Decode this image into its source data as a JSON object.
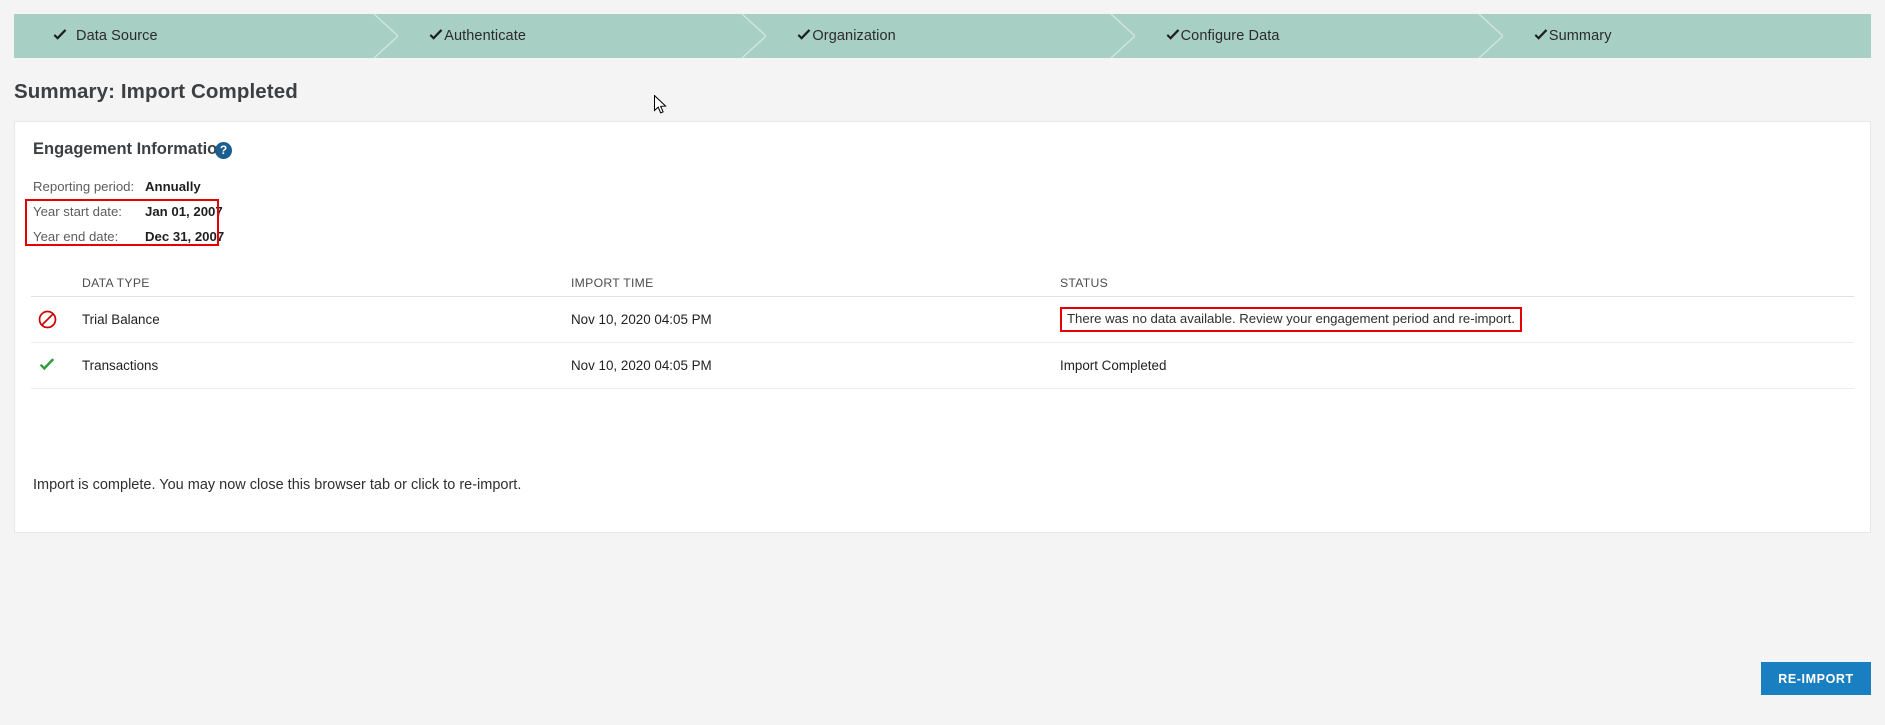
{
  "wizard": {
    "steps": [
      {
        "label": "Data Source",
        "icon": "check-icon",
        "complete": true
      },
      {
        "label": "Authenticate",
        "icon": "check-icon",
        "complete": true
      },
      {
        "label": "Organization",
        "icon": "check-icon",
        "complete": true
      },
      {
        "label": "Configure Data",
        "icon": "check-icon",
        "complete": true
      },
      {
        "label": "Summary",
        "icon": "check-icon",
        "complete": true
      }
    ],
    "bar_color": "#a8cfc4"
  },
  "page": {
    "title": "Summary: Import Completed"
  },
  "card": {
    "title": "Engagement Information",
    "help_icon_label": "?",
    "info": [
      {
        "label": "Reporting period:",
        "value": "Annually"
      },
      {
        "label": "Year start date:",
        "value": "Jan 01, 2007"
      },
      {
        "label": "Year end date:",
        "value": "Dec 31, 2007"
      }
    ],
    "highlight_color": "#e60000"
  },
  "table": {
    "headers": {
      "data_type": "DATA TYPE",
      "import_time": "IMPORT TIME",
      "status": "STATUS"
    },
    "rows": [
      {
        "icon": "no-entry-icon",
        "icon_color": "#cc0000",
        "data_type": "Trial Balance",
        "import_time": "Nov 10, 2020 04:05 PM",
        "status": "There was no data available. Review your engagement period and re-import.",
        "status_error": true
      },
      {
        "icon": "check-icon",
        "icon_color": "#2e9e3e",
        "data_type": "Transactions",
        "import_time": "Nov 10, 2020 04:05 PM",
        "status": "Import Completed",
        "status_error": false
      }
    ]
  },
  "footer": {
    "note": "Import is complete. You may now close this browser tab or click to re-import.",
    "reimport_label": "RE-IMPORT",
    "reimport_color": "#1a7fc1"
  }
}
